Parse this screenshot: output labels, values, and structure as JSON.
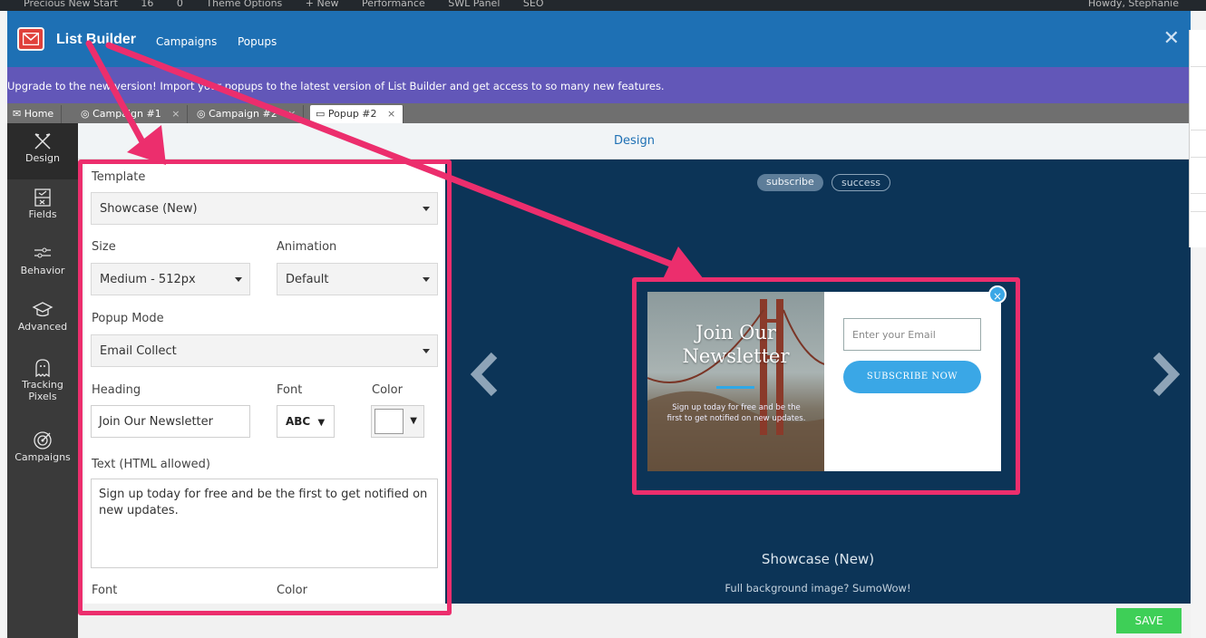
{
  "wp_bar": {
    "items": [
      "Precious New Start",
      "16",
      "0",
      "Theme Options",
      "+ New",
      "Performance",
      "SWL Panel",
      "SEO"
    ],
    "howdy": "Howdy, Stephanie"
  },
  "header": {
    "brand": "List Builder",
    "nav": [
      "Campaigns",
      "Popups"
    ],
    "close": "✕"
  },
  "banner": "Upgrade to the new version! Import your popups to the latest version of List Builder and get access to so many new features.",
  "tabs": [
    {
      "label": "Home",
      "icon": "envelope-icon"
    },
    {
      "label": "Campaign #1",
      "icon": "target-icon",
      "close": "×"
    },
    {
      "label": "Campaign #2",
      "icon": "target-icon",
      "close": "×"
    },
    {
      "label": "Popup #2",
      "icon": "window-icon",
      "close": "×"
    }
  ],
  "sidebar": [
    {
      "label": "Design",
      "icon": "design-icon"
    },
    {
      "label": "Fields",
      "icon": "fields-icon"
    },
    {
      "label": "Behavior",
      "icon": "sliders-icon"
    },
    {
      "label": "Advanced",
      "icon": "graduation-cap-icon"
    },
    {
      "label": "Tracking Pixels",
      "icon": "ghost-icon"
    },
    {
      "label": "Campaigns",
      "icon": "target-icon"
    }
  ],
  "designbar_title": "Design",
  "form": {
    "template_label": "Template",
    "template_value": "Showcase (New)",
    "size_label": "Size",
    "size_value": "Medium - 512px",
    "animation_label": "Animation",
    "animation_value": "Default",
    "mode_label": "Popup Mode",
    "mode_value": "Email Collect",
    "heading_label": "Heading",
    "heading_value": "Join Our Newsletter",
    "font_label": "Font",
    "font_value": "ABC",
    "color_label": "Color",
    "color_value": "#ffffff",
    "text_label": "Text (HTML allowed)",
    "text_value": "Sign up today for free and be the first to get notified on new updates.",
    "font2_label": "Font",
    "color2_label": "Color"
  },
  "preview": {
    "state_tabs": [
      "subscribe",
      "success"
    ],
    "popup_heading": "Join Our Newsletter",
    "popup_sub": "Sign up today for free and be the first to get notified on new updates.",
    "email_placeholder": "Enter your Email",
    "button_label": "SUBSCRIBE NOW",
    "close": "×",
    "template_name": "Showcase (New)",
    "template_hint": "Full background image? SumoWow!",
    "prev": "‹",
    "next": "›"
  },
  "save_label": "SAVE",
  "colors": {
    "header": "#1e70b4",
    "banner": "#6257b8",
    "preview_bg": "#0c3457",
    "accent": "#3aa7e6",
    "save": "#3ecf57",
    "annotation": "#ec2e6d"
  }
}
